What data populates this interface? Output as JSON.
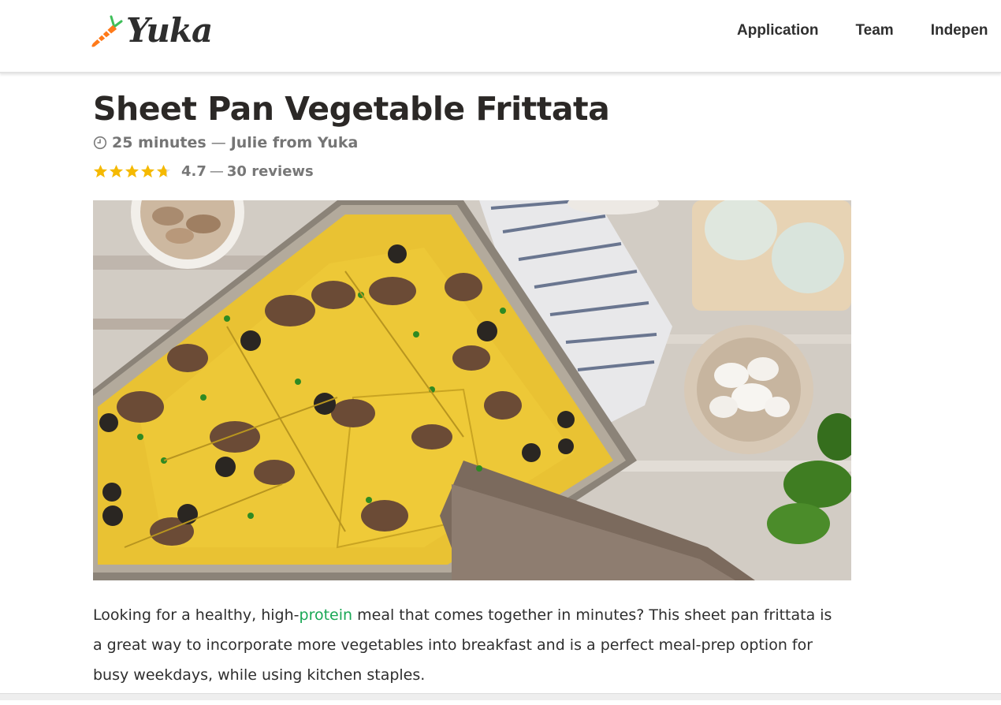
{
  "header": {
    "logo_text": "Yuka",
    "nav": [
      "Application",
      "Team",
      "Indepen"
    ]
  },
  "recipe": {
    "title": "Sheet Pan Vegetable Frittata",
    "duration": "25 minutes",
    "separator": "—",
    "author": "Julie from Yuka",
    "rating": "4.7",
    "rating_value": 4.7,
    "rating_max": 5,
    "reviews": "30 reviews",
    "hero_icon": "photo-sheet-pan-frittata",
    "intro_part1": "Looking for a healthy, high-",
    "intro_link": "protein",
    "intro_part2": " meal that comes together in minutes? This sheet pan frittata is a great way to incorporate more vegetables into breakfast and is a perfect meal-prep option for busy weekdays, while using kitchen staples."
  },
  "colors": {
    "accent_green": "#19a855",
    "star_yellow": "#f5b900",
    "logo_orange": "#ff7a1a",
    "logo_green": "#3fbf5a"
  }
}
